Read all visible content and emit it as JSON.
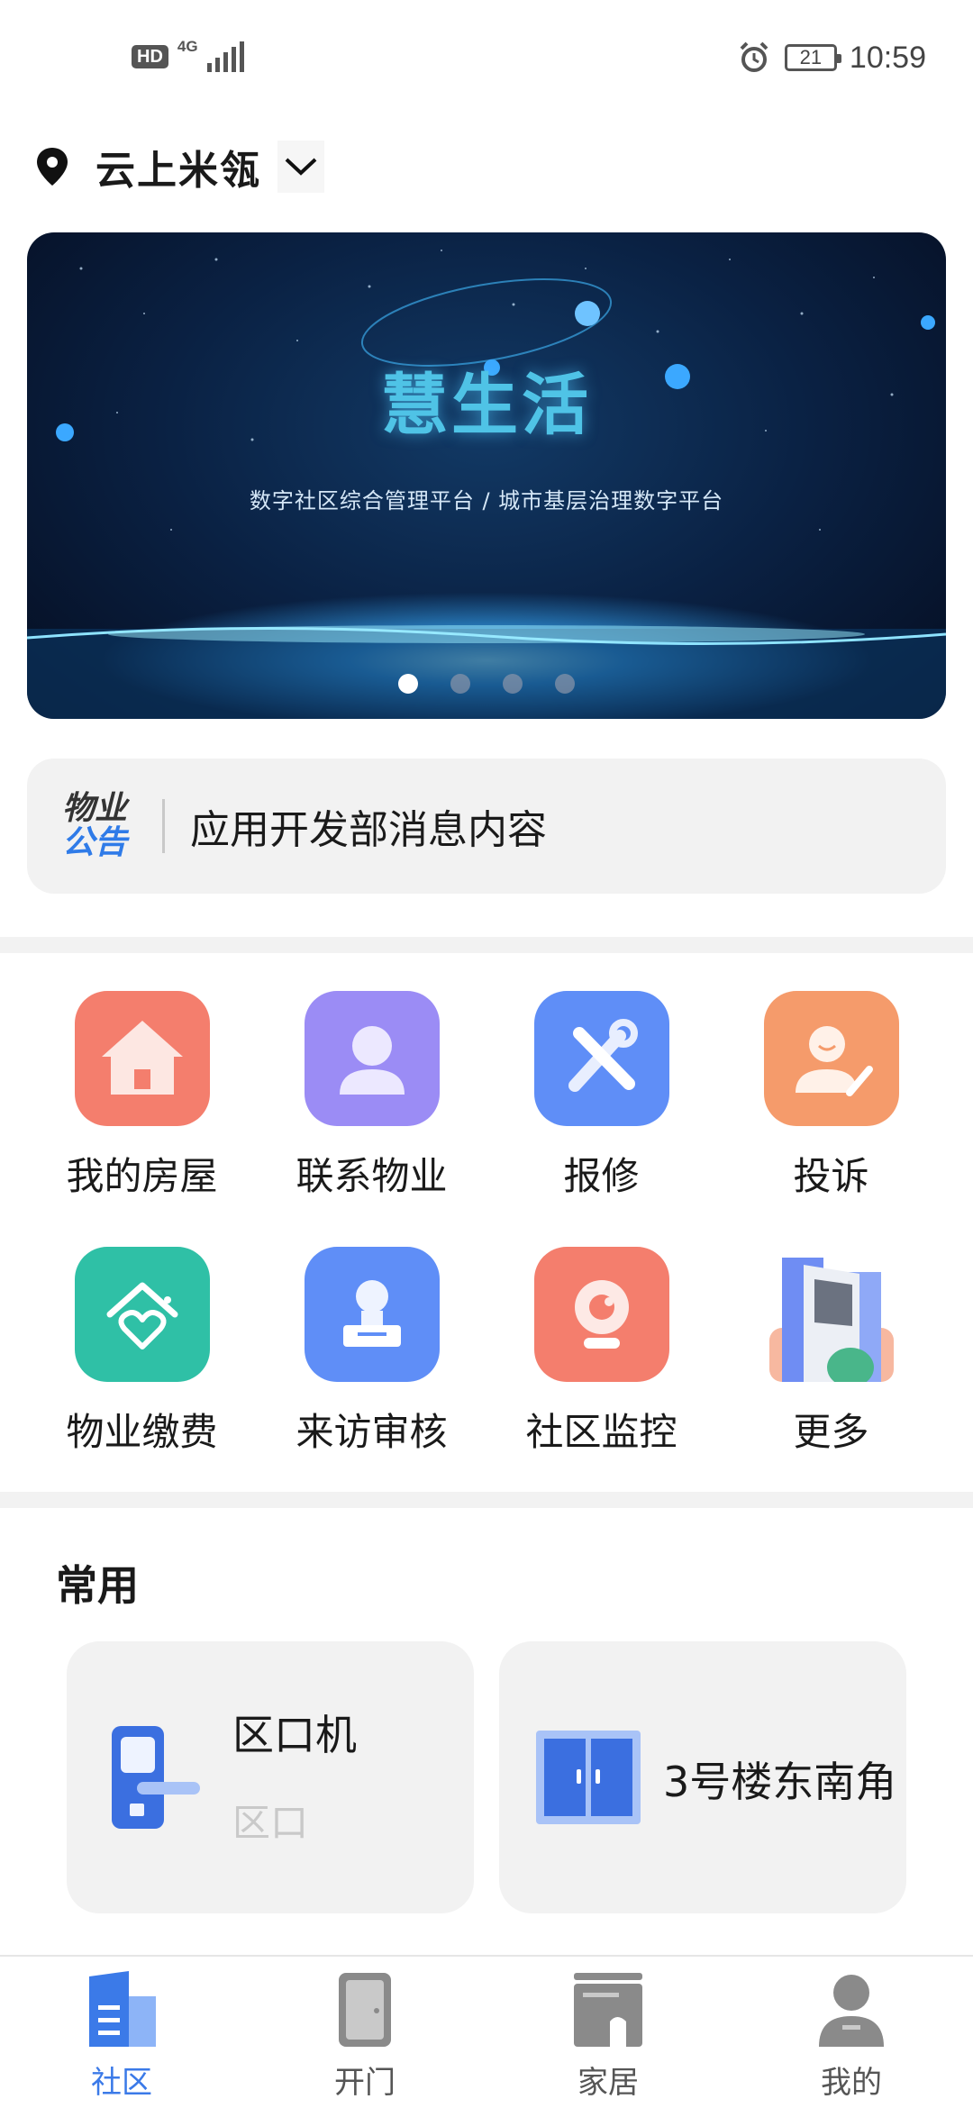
{
  "status_bar": {
    "hd": "HD",
    "network": "4G",
    "battery": "21",
    "time": "10:59"
  },
  "header": {
    "location": "云上米瓴"
  },
  "banner": {
    "title": "慧生活",
    "subtitle": "数字社区综合管理平台 / 城市基层治理数字平台",
    "slide_count": 4,
    "active_slide": 1
  },
  "notice": {
    "logo_line1": "物业",
    "logo_line2": "公告",
    "text": "应用开发部消息内容"
  },
  "services": [
    {
      "label": "我的房屋",
      "icon": "house-icon",
      "color": "#f47e6d"
    },
    {
      "label": "联系物业",
      "icon": "contact-person-icon",
      "color": "#9b8cf5"
    },
    {
      "label": "报修",
      "icon": "repair-tools-icon",
      "color": "#5f8ef7"
    },
    {
      "label": "投诉",
      "icon": "complaint-person-icon",
      "color": "#f59b6b"
    },
    {
      "label": "物业缴费",
      "icon": "payment-heart-icon",
      "color": "#2fc0a6"
    },
    {
      "label": "来访审核",
      "icon": "visitor-review-icon",
      "color": "#5f8ef7"
    },
    {
      "label": "社区监控",
      "icon": "camera-icon",
      "color": "#f47e6d"
    },
    {
      "label": "更多",
      "icon": "more-buildings-icon",
      "color": "#6f8df3"
    }
  ],
  "common": {
    "title": "常用",
    "cards": [
      {
        "title": "区口机",
        "subtitle": "区口",
        "icon": "door-lock-icon"
      },
      {
        "title": "3号楼东南角",
        "icon": "double-door-icon"
      }
    ]
  },
  "tabs": [
    {
      "label": "社区",
      "icon": "community-icon",
      "active": true
    },
    {
      "label": "开门",
      "icon": "door-icon",
      "active": false
    },
    {
      "label": "家居",
      "icon": "home-device-icon",
      "active": false
    },
    {
      "label": "我的",
      "icon": "profile-icon",
      "active": false
    }
  ],
  "colors": {
    "accent": "#3b7ae8",
    "inactive": "#8a8a8a"
  }
}
